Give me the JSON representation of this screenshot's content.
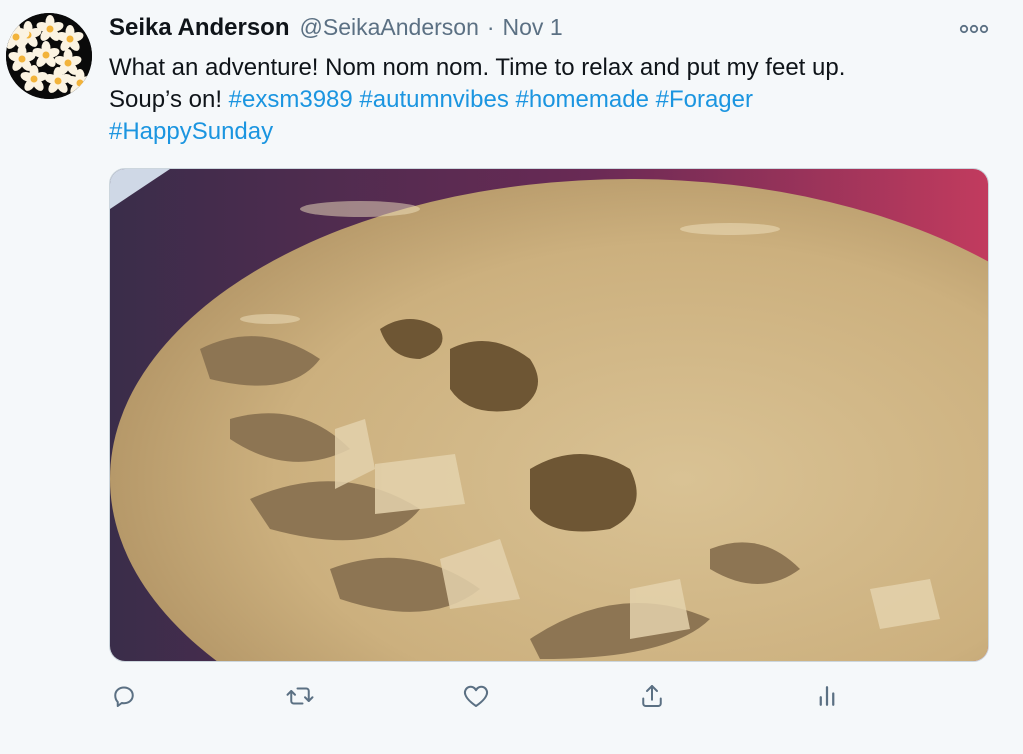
{
  "tweet": {
    "author_name": "Seika Anderson",
    "author_handle": "@SeikaAnderson",
    "separator": "·",
    "date": "Nov 1",
    "text_line1": "What an adventure! Nom nom nom. Time to relax and put my feet up.",
    "text_line2_plain": "Soup’s on! ",
    "hashtags": [
      "#exsm3989",
      "#autumnvibes",
      "#homemade",
      "#Forager",
      "#HappySunday"
    ]
  },
  "colors": {
    "background": "#f5f8fa",
    "hashtag": "#1b95e0",
    "secondary_text": "#5b7083",
    "icon": "#5b7083"
  },
  "icons": [
    "more-icon",
    "reply-icon",
    "retweet-icon",
    "like-icon",
    "share-icon",
    "analytics-icon"
  ]
}
